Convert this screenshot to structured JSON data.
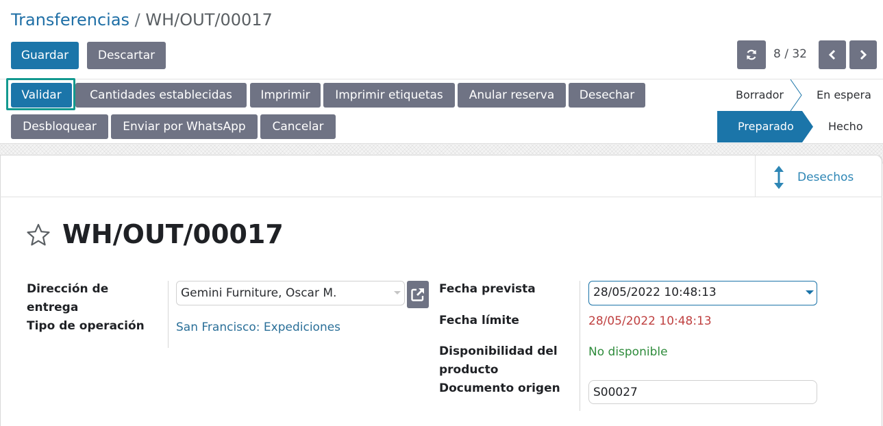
{
  "breadcrumb": {
    "parent": "Transferencias",
    "separator": "/",
    "current": "WH/OUT/00017"
  },
  "toolbar": {
    "save_label": "Guardar",
    "discard_label": "Descartar"
  },
  "pager": {
    "value": "8 / 32"
  },
  "actions": {
    "row1": [
      "Validar",
      "Cantidades establecidas",
      "Imprimir",
      "Imprimir etiquetas",
      "Anular reserva",
      "Desechar"
    ],
    "row2": [
      "Desbloquear",
      "Enviar por WhatsApp",
      "Cancelar"
    ]
  },
  "statusbar": {
    "stages": [
      "Borrador",
      "En espera",
      "Preparado",
      "Hecho"
    ],
    "active": "Preparado"
  },
  "smart_button": {
    "label": "Desechos",
    "icon": "arrows-vertical-icon"
  },
  "record": {
    "title": "WH/OUT/00017",
    "favorite_icon": "star-outline-icon"
  },
  "form": {
    "left": {
      "delivery_address_label_line1": "Dirección de",
      "delivery_address_label_line2": "entrega",
      "operation_type_label": "Tipo de operación",
      "delivery_address_value": "Gemini Furniture, Oscar M.",
      "operation_type_value": "San Francisco: Expediciones"
    },
    "right": {
      "scheduled_date_label": "Fecha prevista",
      "deadline_label": "Fecha límite",
      "availability_label_line1": "Disponibilidad del",
      "availability_label_line2": "producto",
      "origin_label": "Documento origen",
      "scheduled_date_value": "28/05/2022 10:48:13",
      "deadline_value": "28/05/2022 10:48:13",
      "availability_value": "No disponible",
      "origin_value": "S00027"
    }
  },
  "colors": {
    "primary": "#1b75a9",
    "secondary": "#6f7384",
    "highlight": "#12998f",
    "deadline": "#bf4040",
    "availability": "#2e8b3b"
  }
}
